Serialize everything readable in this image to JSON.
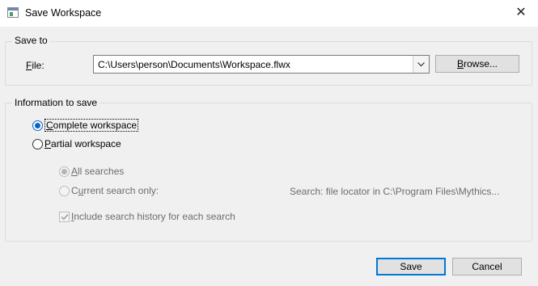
{
  "window": {
    "title": "Save Workspace",
    "icon": "workspace-window-icon",
    "close_glyph": "✕"
  },
  "save_to": {
    "label": "Save to",
    "file_label_mnemonic": "F",
    "file_label_rest": "ile:",
    "file_path": "C:\\Users\\person\\Documents\\Workspace.flwx",
    "browse_mnemonic": "B",
    "browse_rest": "rowse..."
  },
  "info": {
    "label": "Information to save",
    "complete": {
      "mnemonic": "C",
      "rest": "omplete workspace",
      "checked": true
    },
    "partial": {
      "mnemonic": "P",
      "rest": "artial workspace",
      "checked": false
    },
    "all_searches": {
      "mnemonic": "A",
      "rest": "ll searches",
      "checked": true,
      "enabled": false
    },
    "current_search": {
      "pre": "C",
      "mnemonic": "u",
      "rest": "rrent search only:",
      "checked": false,
      "enabled": false
    },
    "search_detail": "Search: file locator in C:\\Program Files\\Mythics...",
    "include_history": {
      "mnemonic": "I",
      "rest": "nclude search history for each search",
      "checked": true,
      "enabled": false
    }
  },
  "buttons": {
    "save": "Save",
    "cancel": "Cancel"
  },
  "colors": {
    "accent": "#0078d7",
    "window_bg": "#f0f0f0",
    "disabled_text": "#6d6d6d"
  }
}
